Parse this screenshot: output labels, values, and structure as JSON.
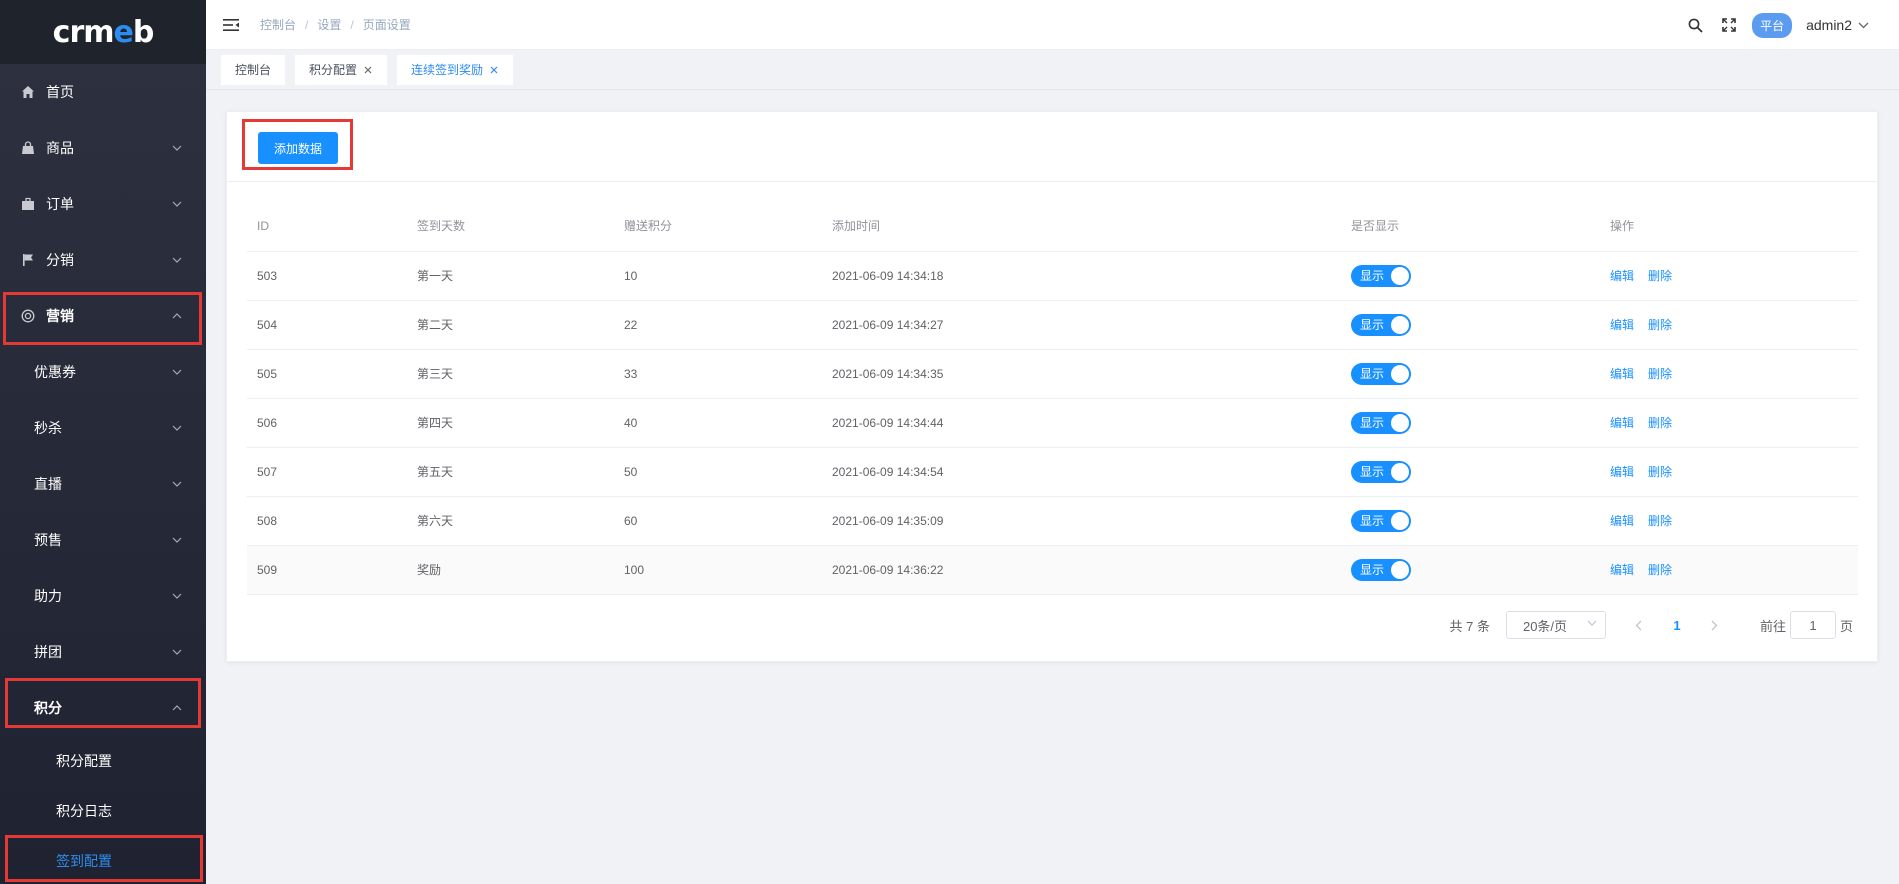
{
  "logo": {
    "text_a": "crm",
    "text_e": "e",
    "text_b": "b"
  },
  "sidebar": {
    "items": [
      {
        "label": "首页",
        "icon": "home-icon"
      },
      {
        "label": "商品",
        "icon": "bag-icon"
      },
      {
        "label": "订单",
        "icon": "briefcase-icon"
      },
      {
        "label": "分销",
        "icon": "flag-icon"
      },
      {
        "label": "营销",
        "icon": "lifebuoy-icon"
      }
    ],
    "marketing_sub": [
      {
        "label": "优惠券"
      },
      {
        "label": "秒杀"
      },
      {
        "label": "直播"
      },
      {
        "label": "预售"
      },
      {
        "label": "助力"
      },
      {
        "label": "拼团"
      },
      {
        "label": "积分"
      }
    ],
    "points_sub": [
      {
        "label": "积分配置"
      },
      {
        "label": "积分日志"
      },
      {
        "label": "签到配置"
      }
    ]
  },
  "header": {
    "breadcrumb": [
      "控制台",
      "设置",
      "页面设置"
    ],
    "platform": "平台",
    "user": "admin2"
  },
  "tags": [
    {
      "label": "控制台"
    },
    {
      "label": "积分配置"
    },
    {
      "label": "连续签到奖励"
    }
  ],
  "main": {
    "add_button": "添加数据",
    "columns": [
      "ID",
      "签到天数",
      "赠送积分",
      "添加时间",
      "是否显示",
      "操作"
    ],
    "rows": [
      {
        "id": "503",
        "day": "第一天",
        "points": "10",
        "time": "2021-06-09 14:34:18",
        "show": "显示"
      },
      {
        "id": "504",
        "day": "第二天",
        "points": "22",
        "time": "2021-06-09 14:34:27",
        "show": "显示"
      },
      {
        "id": "505",
        "day": "第三天",
        "points": "33",
        "time": "2021-06-09 14:34:35",
        "show": "显示"
      },
      {
        "id": "506",
        "day": "第四天",
        "points": "40",
        "time": "2021-06-09 14:34:44",
        "show": "显示"
      },
      {
        "id": "507",
        "day": "第五天",
        "points": "50",
        "time": "2021-06-09 14:34:54",
        "show": "显示"
      },
      {
        "id": "508",
        "day": "第六天",
        "points": "60",
        "time": "2021-06-09 14:35:09",
        "show": "显示"
      },
      {
        "id": "509",
        "day": "奖励",
        "points": "100",
        "time": "2021-06-09 14:36:22",
        "show": "显示"
      }
    ],
    "edit_label": "编辑",
    "delete_label": "删除"
  },
  "pagination": {
    "total": "共 7 条",
    "page_size": "20条/页",
    "current": "1",
    "goto_prefix": "前往",
    "goto_value": "1",
    "goto_suffix": "页"
  },
  "colors": {
    "primary": "#1890ff",
    "highlight": "#e53935",
    "sidebar": "#282c34"
  }
}
